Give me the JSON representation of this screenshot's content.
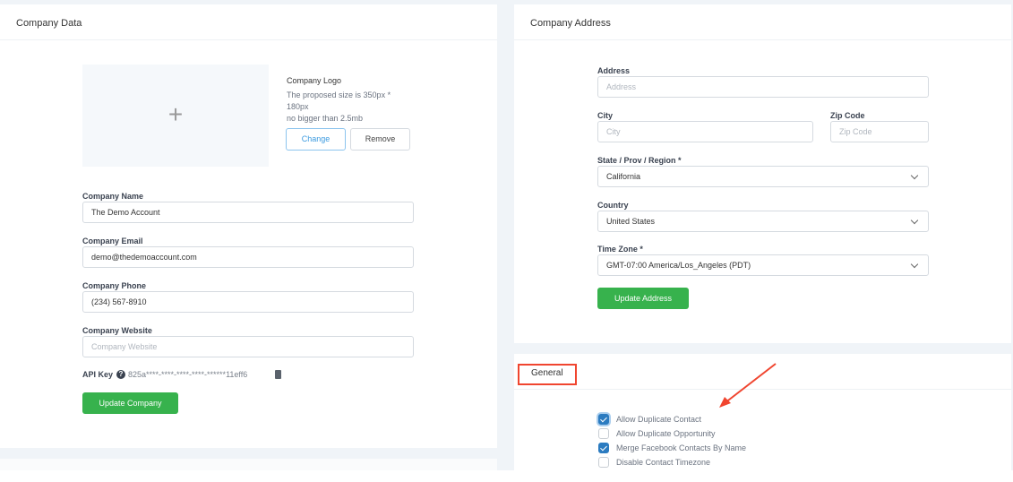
{
  "company_data": {
    "title": "Company Data",
    "logo": {
      "label": "Company Logo",
      "hint1": "The proposed size is 350px *",
      "hint2": "180px",
      "hint3": "no bigger than 2.5mb",
      "change": "Change",
      "remove": "Remove"
    },
    "fields": [
      {
        "label": "Company Name",
        "value": "The Demo Account",
        "placeholder": ""
      },
      {
        "label": "Company Email",
        "value": "demo@thedemoaccount.com",
        "placeholder": ""
      },
      {
        "label": "Company Phone",
        "value": "(234) 567-8910",
        "placeholder": ""
      },
      {
        "label": "Company Website",
        "value": "",
        "placeholder": "Company Website"
      }
    ],
    "api_key_label": "API Key",
    "api_key": "825a****-****-****-****-******11eff6",
    "update": "Update Company"
  },
  "company_address": {
    "title": "Company Address",
    "address": {
      "label": "Address",
      "placeholder": "Address"
    },
    "city": {
      "label": "City",
      "placeholder": "City"
    },
    "zip": {
      "label": "Zip Code",
      "placeholder": "Zip Code"
    },
    "state": {
      "label": "State / Prov / Region *",
      "value": "California"
    },
    "country": {
      "label": "Country",
      "value": "United States"
    },
    "timezone": {
      "label": "Time Zone *",
      "value": "GMT-07:00 America/Los_Angeles (PDT)"
    },
    "update": "Update Address"
  },
  "general": {
    "title": "General",
    "options": [
      {
        "label": "Allow Duplicate Contact",
        "checked": true
      },
      {
        "label": "Allow Duplicate Opportunity",
        "checked": false
      },
      {
        "label": "Merge Facebook Contacts By Name",
        "checked": true
      },
      {
        "label": "Disable Contact Timezone",
        "checked": false
      }
    ]
  },
  "colors": {
    "accent": "#37b24d",
    "checkbox": "#2b7bc0",
    "annotation": "#f0452f"
  }
}
